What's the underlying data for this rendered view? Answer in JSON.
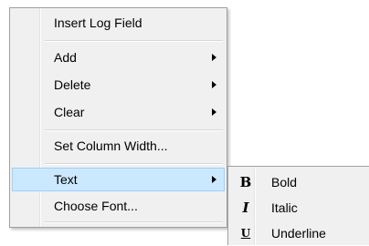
{
  "context_menu": {
    "items": {
      "insert_log_field": {
        "label": "Insert Log Field"
      },
      "add": {
        "label": "Add"
      },
      "delete": {
        "label": "Delete"
      },
      "clear": {
        "label": "Clear"
      },
      "set_column_width": {
        "label": "Set Column Width..."
      },
      "text": {
        "label": "Text"
      },
      "choose_font": {
        "label": "Choose Font..."
      }
    }
  },
  "text_submenu": {
    "items": [
      {
        "glyph": "B",
        "label": "Bold"
      },
      {
        "glyph": "I",
        "label": "Italic"
      },
      {
        "glyph": "U",
        "label": "Underline"
      }
    ]
  },
  "colors": {
    "menu_background": "#f0f0f0",
    "menu_border": "#a0a0a0",
    "highlight_background": "#cce8ff",
    "highlight_border": "#99d1ff"
  }
}
